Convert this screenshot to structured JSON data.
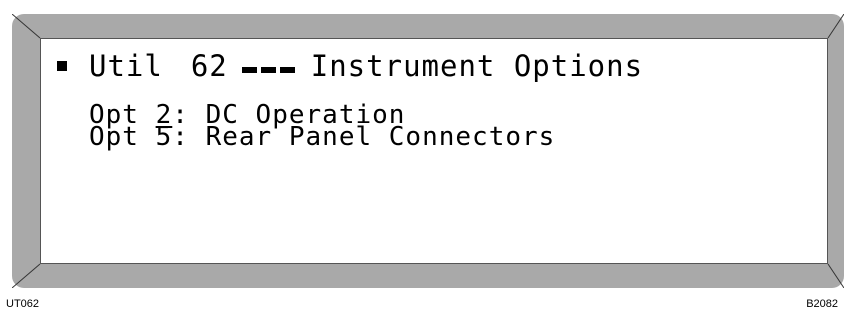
{
  "display": {
    "title": {
      "prefix": "Util",
      "menu_number": "62",
      "name": "Instrument Options"
    },
    "options": [
      {
        "label": "Opt",
        "number": "2",
        "colon": ":",
        "text": "DC Operation"
      },
      {
        "label": "Opt",
        "number": "5",
        "colon": ":",
        "text": "Rear Panel Connectors"
      }
    ]
  },
  "footer": {
    "left_code": "UT062",
    "right_code": "B2082"
  }
}
